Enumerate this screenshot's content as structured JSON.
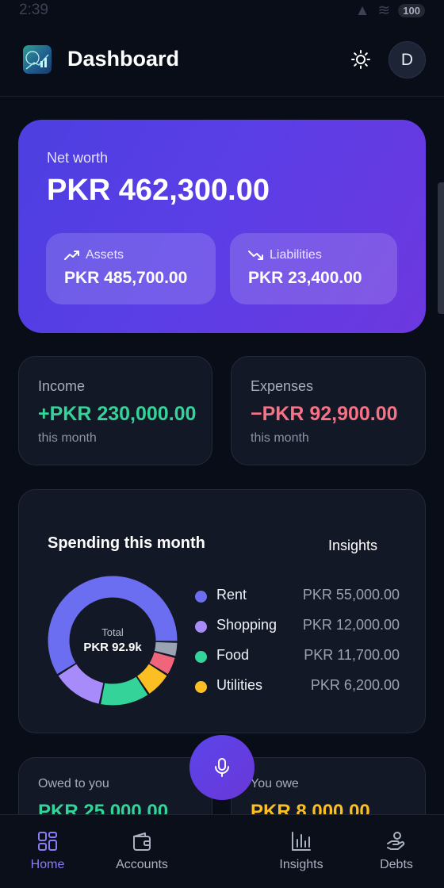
{
  "status_bar": {
    "time": "2:39",
    "battery": "100"
  },
  "header": {
    "title": "Dashboard",
    "avatar_initial": "D"
  },
  "net_worth": {
    "label": "Net worth",
    "value": "PKR 462,300.00",
    "assets_label": "Assets",
    "assets_value": "PKR 485,700.00",
    "liabilities_label": "Liabilities",
    "liabilities_value": "PKR 23,400.00"
  },
  "income": {
    "label": "Income",
    "value": "+PKR 230,000.00",
    "period": "this month"
  },
  "expenses": {
    "label": "Expenses",
    "value": "−PKR 92,900.00",
    "period": "this month"
  },
  "spending": {
    "title": "Spending this month",
    "insights_label": "Insights",
    "total_label": "Total",
    "total_value": "PKR 92.9k",
    "legend": [
      {
        "name": "Rent",
        "amount": "PKR 55,000.00",
        "color": "#6b6ef0"
      },
      {
        "name": "Shopping",
        "amount": "PKR 12,000.00",
        "color": "#a78bfa"
      },
      {
        "name": "Food",
        "amount": "PKR 11,700.00",
        "color": "#34d399"
      },
      {
        "name": "Utilities",
        "amount": "PKR 6,200.00",
        "color": "#fbbf24"
      }
    ]
  },
  "chart_data": {
    "type": "pie",
    "title": "Spending this month",
    "categories": [
      "Rent",
      "Shopping",
      "Food",
      "Utilities",
      "Other (red)",
      "Other (gray)"
    ],
    "values": [
      55000,
      12000,
      11700,
      6200,
      4500,
      3500
    ],
    "colors": [
      "#6b6ef0",
      "#a78bfa",
      "#34d399",
      "#fbbf24",
      "#f0657a",
      "#9aa3b2"
    ]
  },
  "debts": {
    "owed_label": "Owed to you",
    "owed_value": "PKR 25,000.00",
    "owe_label": "You owe",
    "owe_value": "PKR 8,000.00"
  },
  "nav": {
    "items": [
      {
        "label": "Home",
        "icon": "grid-icon"
      },
      {
        "label": "Accounts",
        "icon": "wallet-icon"
      },
      {
        "label": "Insights",
        "icon": "bar-chart-icon"
      },
      {
        "label": "Debts",
        "icon": "handshake-icon"
      }
    ]
  }
}
